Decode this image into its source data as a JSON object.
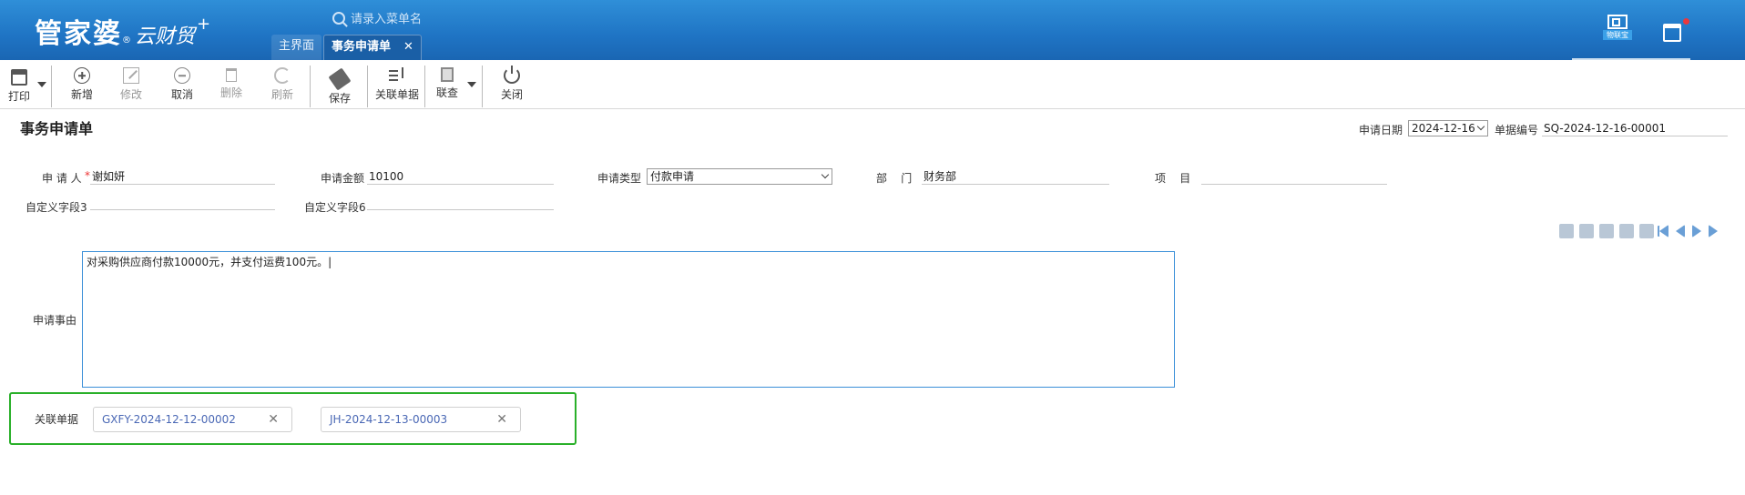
{
  "app": {
    "logo_main": "管家婆",
    "logo_reg": "®",
    "logo_sub": "云财贸",
    "logo_plus": "+",
    "search_placeholder": "请录入菜单名",
    "tabs": [
      {
        "label": "主界面",
        "active": false
      },
      {
        "label": "事务申请单",
        "active": true,
        "close": "✕"
      }
    ],
    "wuliantong_label": "物联宝"
  },
  "toolbar": {
    "print": "打印",
    "add": "新增",
    "edit": "修改",
    "cancel": "取消",
    "delete": "删除",
    "refresh": "刷新",
    "save": "保存",
    "link_doc": "关联单据",
    "query": "联查",
    "close": "关闭"
  },
  "form": {
    "title": "事务申请单",
    "date_label": "申请日期",
    "date_value": "2024-12-16",
    "docno_label": "单据编号",
    "docno_value": "SQ-2024-12-16-00001",
    "applicant_label": "申 请 人",
    "applicant_req": "*",
    "applicant_value": "谢如妍",
    "amount_label": "申请金额",
    "amount_value": "10100",
    "type_label": "申请类型",
    "type_value": "付款申请",
    "dept_label": "部    门",
    "dept_value": "财务部",
    "project_label": "项    目",
    "project_value": "",
    "custom3_label": "自定义字段3",
    "custom3_value": "",
    "custom6_label": "自定义字段6",
    "custom6_value": "",
    "reason_label": "申请事由",
    "reason_value": "对采购供应商付款10000元，并支付运费100元。|",
    "linked_label": "关联单据",
    "linked_docs": [
      {
        "code": "GXFY-2024-12-12-00002",
        "close": "✕"
      },
      {
        "code": "JH-2024-12-13-00003",
        "close": "✕"
      }
    ]
  },
  "colors": {
    "header_blue": "#1f74c4",
    "highlight_green": "#2ab02a",
    "link_blue": "#4a68b5"
  }
}
